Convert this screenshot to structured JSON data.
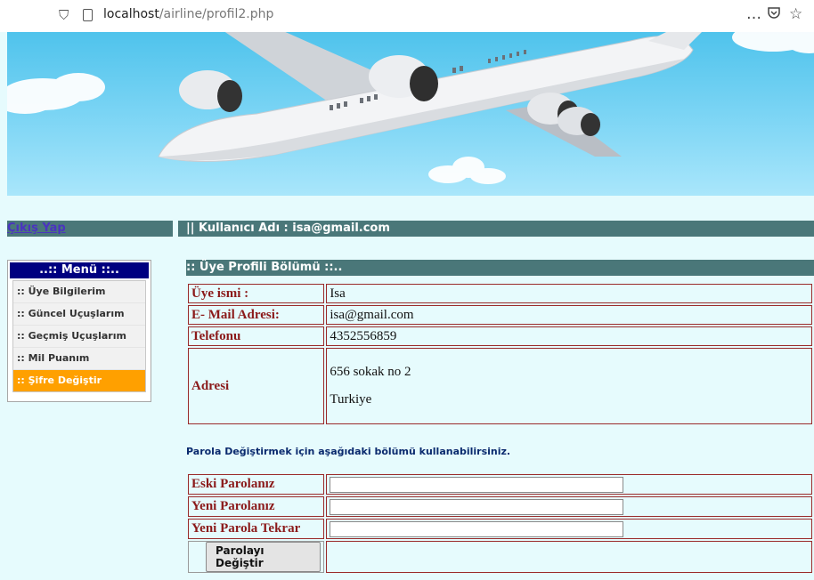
{
  "browser": {
    "url_host": "localhost",
    "url_path": "/airline/profil2.php",
    "more_icon": "…",
    "pocket_icon": "pocket-icon",
    "star_icon": "☆"
  },
  "header": {
    "logout_label": "Çıkış Yap",
    "user_label": "|| Kullanıcı Adı : isa@gmail.com"
  },
  "menu": {
    "title": "..:: Menü ::..",
    "items": [
      {
        "label": ":: Üye Bilgilerim"
      },
      {
        "label": ":: Güncel Uçuşlarım"
      },
      {
        "label": ":: Geçmiş Uçuşlarım"
      },
      {
        "label": ":: Mil Puanım"
      },
      {
        "label": ":: Şifre Değiştir"
      }
    ]
  },
  "profile": {
    "section_title": ":: Üye Profili Bölümü ::..",
    "rows": [
      {
        "label": "Üye ismi :",
        "value": "Isa"
      },
      {
        "label": "E- Mail Adresi:",
        "value": "isa@gmail.com"
      },
      {
        "label": "Telefonu",
        "value": "4352556859"
      }
    ],
    "address_label": "Adresi",
    "address_line1": "656 sokak no 2",
    "address_line2": "Turkiye"
  },
  "password": {
    "note": "Parola Değiştirmek için aşağıdaki bölümü kullanabilirsiniz.",
    "old_label": "Eski Parolanız",
    "new_label": "Yeni Parolanız",
    "repeat_label": "Yeni Parola Tekrar",
    "old_value": "",
    "new_value": "",
    "repeat_value": "",
    "submit_label": "Parolayı Değiştir"
  },
  "colors": {
    "page_bg": "#e6fbfd",
    "bar_bg": "#4a7779",
    "menu_title_bg": "#000080",
    "active_item_bg": "#ffa000",
    "label_red": "#8b1a1a"
  }
}
